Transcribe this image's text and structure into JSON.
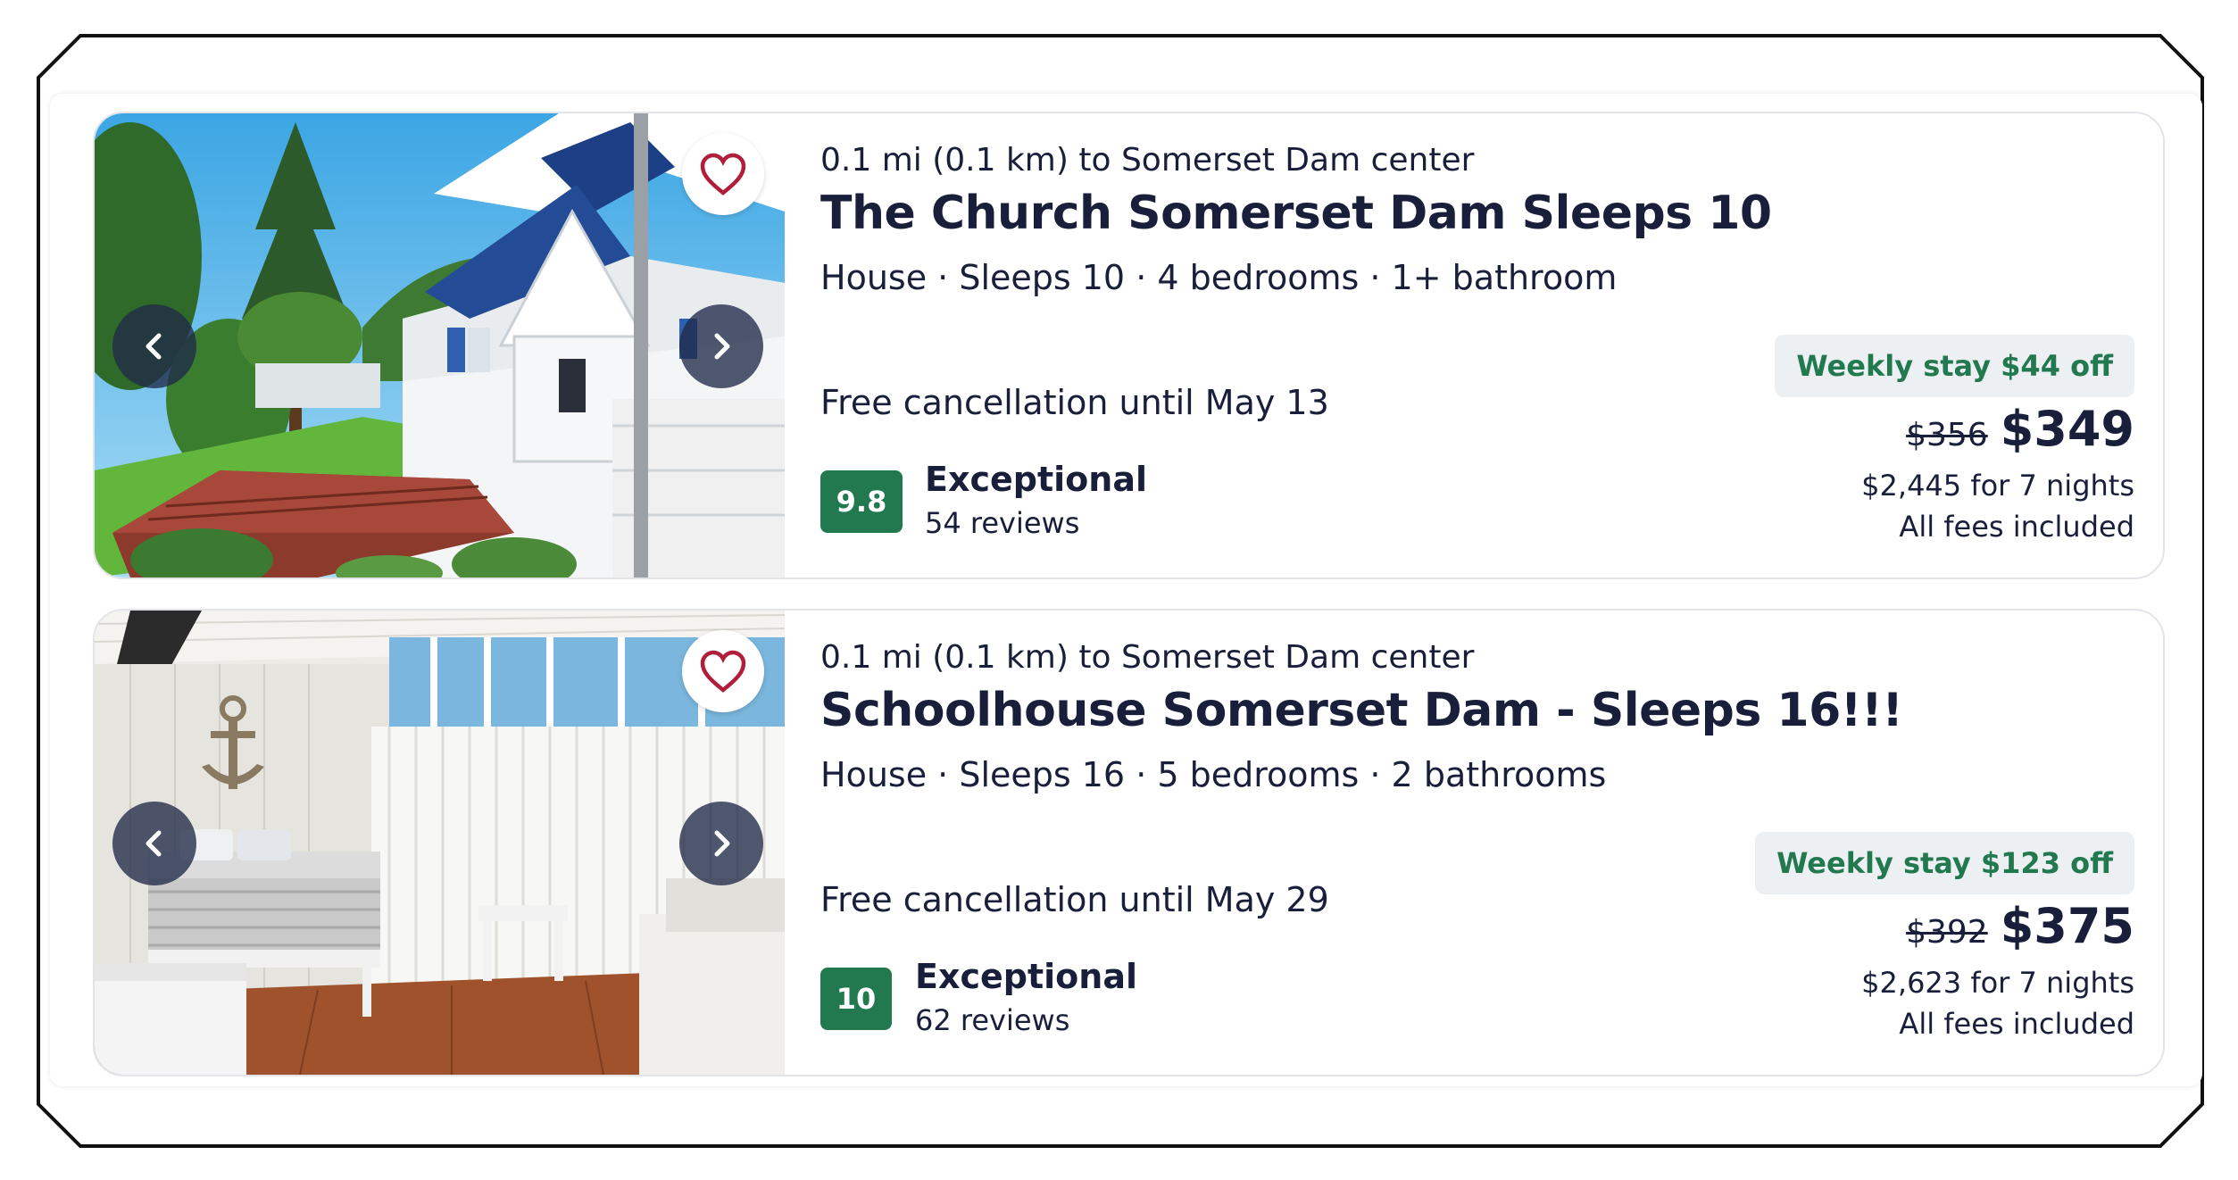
{
  "listings": [
    {
      "distance": "0.1 mi (0.1 km) to Somerset Dam center",
      "title": "The Church Somerset Dam Sleeps 10",
      "details": "House · Sleeps 10 · 4 bedrooms · 1+ bathroom",
      "cancellation": "Free cancellation until May 13",
      "score": "9.8",
      "rating_label": "Exceptional",
      "reviews": "54 reviews",
      "deal": "Weekly stay $44 off",
      "old_price": "$356",
      "price": "$349",
      "total": "$2,445 for 7 nights",
      "fees": "All fees included",
      "photo_icon": "church-exterior-photo"
    },
    {
      "distance": "0.1 mi (0.1 km) to Somerset Dam center",
      "title": "Schoolhouse Somerset Dam - Sleeps 16!!!",
      "details": "House · Sleeps 16 · 5 bedrooms · 2 bathrooms",
      "cancellation": "Free cancellation until May 29",
      "score": "10",
      "rating_label": "Exceptional",
      "reviews": "62 reviews",
      "deal": "Weekly stay $123 off",
      "old_price": "$392",
      "price": "$375",
      "total": "$2,623 for 7 nights",
      "fees": "All fees included",
      "photo_icon": "bedroom-interior-photo"
    }
  ],
  "icons": {
    "prev": "chevron-left-icon",
    "next": "chevron-right-icon",
    "favorite": "heart-icon"
  },
  "colors": {
    "score_badge": "#227950",
    "deal_text": "#227950",
    "deal_background": "#edf0f2",
    "heart": "#b01e3c",
    "text": "#191e3b"
  }
}
